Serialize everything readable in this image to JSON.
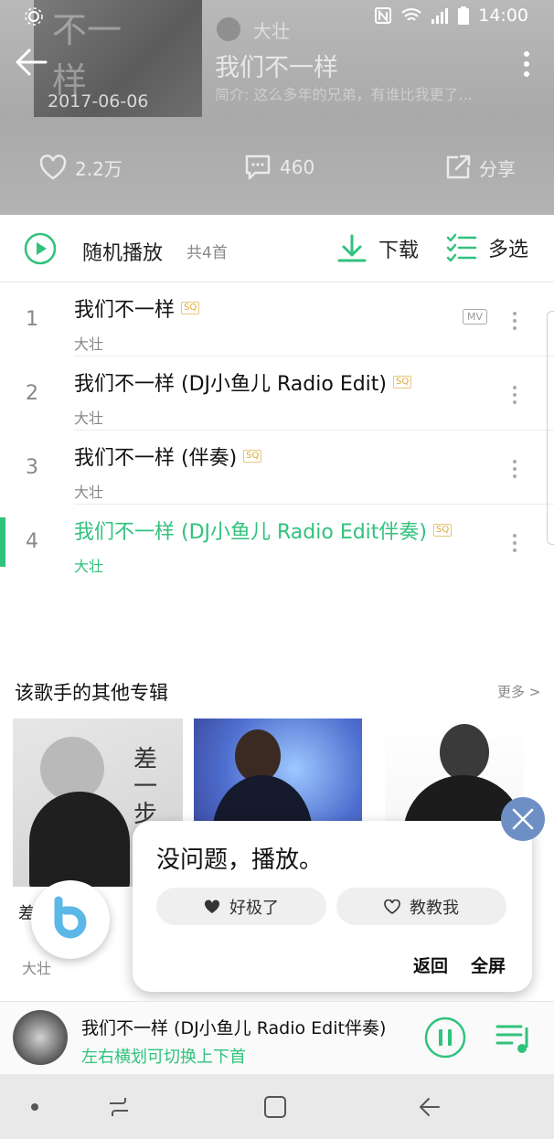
{
  "status_bar": {
    "time": "14:00"
  },
  "header": {
    "cover_date": "2017-06-06",
    "cover_art_text": "不一样",
    "artist": "大壮",
    "album_title": "我们不一样",
    "intro": "简介: 这么多年的兄弟，有谁比我更了...",
    "likes": "2.2万",
    "comments": "460",
    "share": "分享"
  },
  "controls": {
    "shuffle_label": "随机播放",
    "song_count": "共4首",
    "download_label": "下载",
    "multiselect_label": "多选"
  },
  "tracks": [
    {
      "index": "1",
      "title": "我们不一样",
      "artist": "大壮",
      "badge": "SQ",
      "mv": "MV"
    },
    {
      "index": "2",
      "title": "我们不一样 (DJ小鱼儿 Radio Edit)",
      "artist": "大壮",
      "badge": "SQ"
    },
    {
      "index": "3",
      "title": "我们不一样 (伴奏)",
      "artist": "大壮",
      "badge": "SQ"
    },
    {
      "index": "4",
      "title": "我们不一样 (DJ小鱼儿 Radio Edit伴奏)",
      "artist": "大壮",
      "badge": "SQ",
      "active": true
    }
  ],
  "other_albums": {
    "title": "该歌手的其他专辑",
    "more": "更多 >",
    "first_album_partial": "差",
    "first_album_art_text": "差一步",
    "artist": "大壮"
  },
  "bixby_popup": {
    "message": "没问题，播放。",
    "like_label": "好极了",
    "teach_label": "教教我",
    "back_label": "返回",
    "fullscreen_label": "全屏"
  },
  "player": {
    "title": "我们不一样 (DJ小鱼儿 Radio Edit伴奏)",
    "hint": "左右横划可切换上下首"
  },
  "colors": {
    "accent": "#31c27c",
    "bixby_close": "#6e8fc4"
  }
}
